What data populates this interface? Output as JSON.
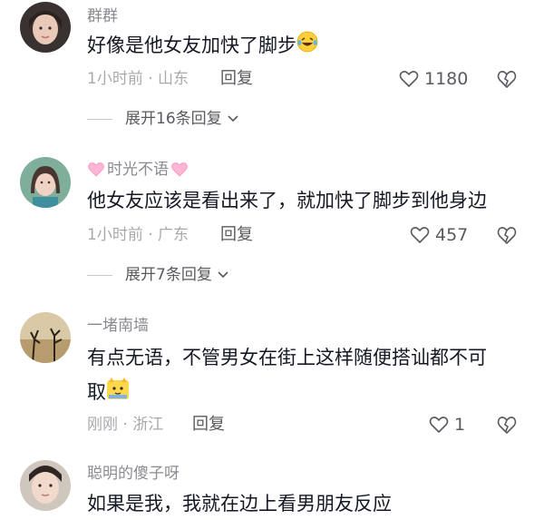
{
  "comments": [
    {
      "username": "群群",
      "text": "好像是他女友加快了脚步",
      "time": "1小时前",
      "location": "山东",
      "reply_label": "回复",
      "likes": "1180",
      "expand_label": "展开16条回复",
      "emoji_icon": "laughing-tears-icon"
    },
    {
      "username": "时光不语",
      "username_decor_icon": "heart-icon",
      "text": "他女友应该是看出来了，就加快了脚步到他身边",
      "time": "1小时前",
      "location": "广东",
      "reply_label": "回复",
      "likes": "457",
      "expand_label": "展开7条回复"
    },
    {
      "username": "一堵南墙",
      "text_line1": "有点无语，不管男女在街上这样随便搭讪都不可",
      "text_line2": "取",
      "time": "刚刚",
      "location": "浙江",
      "reply_label": "回复",
      "likes": "1",
      "emoji_icon": "cat-face-icon"
    },
    {
      "username": "聪明的傻子呀",
      "text": "如果是我，我就在边上看男朋友反应"
    }
  ],
  "separator": "·",
  "colors": {
    "text_primary": "#161823",
    "text_secondary": "#8a8b91",
    "meta": "#a8a9ae",
    "action": "#595a5f"
  }
}
